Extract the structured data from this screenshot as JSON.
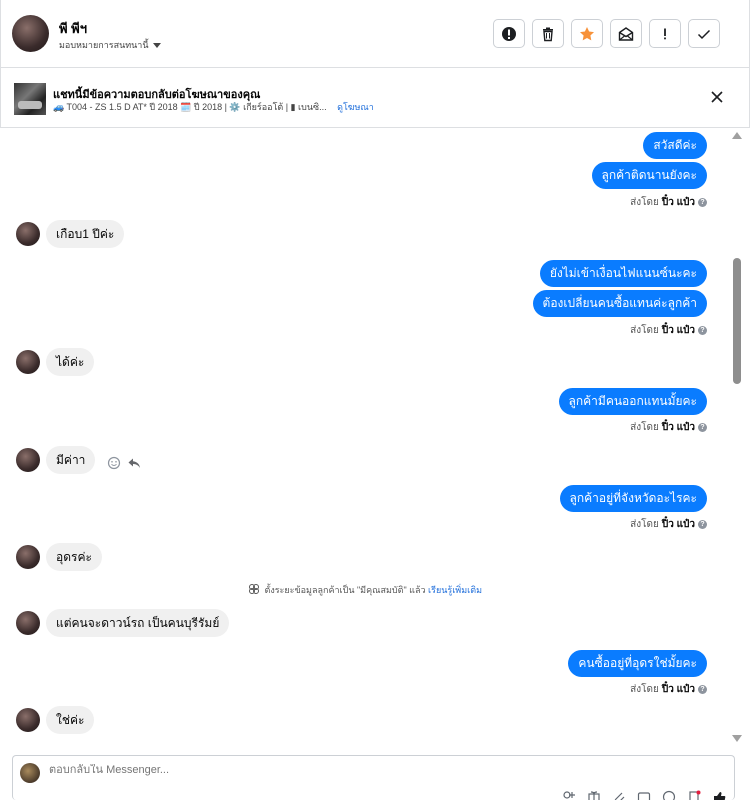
{
  "header": {
    "contact_name": "พี พีฯ",
    "assign_label": "มอบหมายการสนทนานี้",
    "toolbar": [
      {
        "icon": "alert-circle-icon",
        "label": "Mark as spam"
      },
      {
        "icon": "trash-icon",
        "label": "Delete"
      },
      {
        "icon": "star-icon",
        "label": "Follow up"
      },
      {
        "icon": "mail-open-icon",
        "label": "Mark as unread"
      },
      {
        "icon": "exclamation-icon",
        "label": "Report"
      },
      {
        "icon": "check-icon",
        "label": "Mark as done"
      }
    ]
  },
  "ad": {
    "title": "แชทนี้มีข้อความตอบกลับต่อโฆษณาของคุณ",
    "meta": "🚙 T004 - ZS 1.5 D AT* ปี 2018 🗓️ ปี 2018 | ⚙️ เกียร์ออโต้ | ▮ เบนซิ...",
    "view_ad": "ดูโฆษณา"
  },
  "messages": {
    "m1": "สวัสดีค่ะ",
    "m2": "ลูกค้าติดนานยังคะ",
    "sent1_prefix": "ส่งโดย",
    "sent1_name": "ปิ๋ว แป๋ว",
    "m3": "เกือบ1 ปีค่ะ",
    "m4": "ยังไม่เข้าเงื่อนไฟแนนซ์นะคะ",
    "m5": "ต้องเปลี่ยนคนซื้อแทนค่ะลูกค้า",
    "sent2_prefix": "ส่งโดย",
    "sent2_name": "ปิ๋ว แป๋ว",
    "m6": "ได้ค่ะ",
    "m7": "ลูกค้ามีคนออกแทนมั้ยคะ",
    "sent3_prefix": "ส่งโดย",
    "sent3_name": "ปิ๋ว แป๋ว",
    "m8": "มีค่าา",
    "m9": "ลูกค้าอยู่ที่จังหวัดอะไรคะ",
    "sent4_prefix": "ส่งโดย",
    "sent4_name": "ปิ๋ว แป๋ว",
    "m10": "อุดรค่ะ",
    "system_text": "ตั้งระยะข้อมูลลูกค้าเป็น \"มีคุณสมบัติ\" แล้ว",
    "system_link": "เรียนรู้เพิ่มเติม",
    "m11": "แต่คนจะดาวน์รถ เป็นคนบุรีรัมย์",
    "m12": "คนซื้ออยู่ที่อุดรใช่มั้ยคะ",
    "sent5_prefix": "ส่งโดย",
    "sent5_name": "ปิ๋ว แป๋ว",
    "m13": "ใช่ค่ะ"
  },
  "composer": {
    "placeholder": "ตอบกลับใน Messenger..."
  },
  "colors": {
    "outgoing_bubble": "#0a7cff",
    "incoming_bubble": "#f0f0f0",
    "star": "#f7923a",
    "link": "#216fdb"
  }
}
